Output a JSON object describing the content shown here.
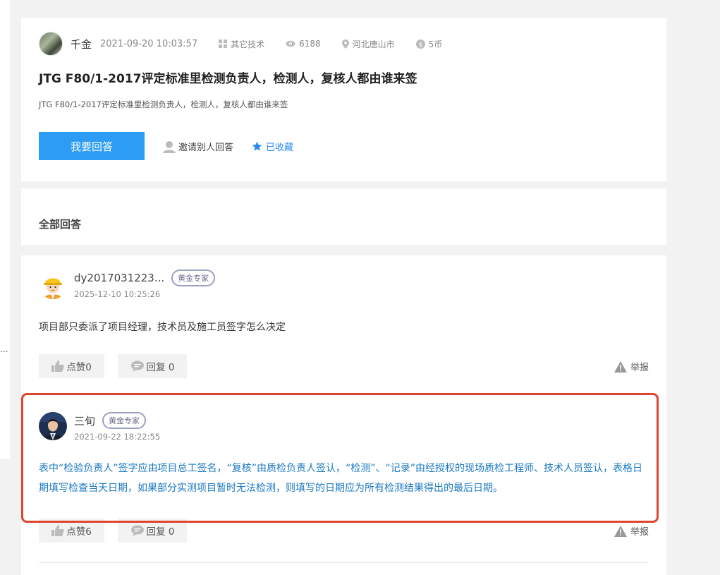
{
  "left_strip": {
    "ellipsis": "..."
  },
  "question": {
    "user": "千金",
    "time": "2021-09-20 10:03:57",
    "category": "其它技术",
    "views": "6188",
    "location": "河北唐山市",
    "reward": "5币",
    "title": "JTG F80/1-2017评定标准里检测负责人，检测人，复核人都由谁来签",
    "description": "JTG F80/1-2017评定标准里检测负责人，检测人，复核人都由谁来签",
    "answer_button": "我要回答",
    "invite_label": "邀请别人回答",
    "favorite_label": "已收藏",
    "favorite_color": "#2d8cf0",
    "answer_button_color": "#2d9cf5"
  },
  "all_answers_title": "全部回答",
  "answers": [
    {
      "user": "dy2017031223...",
      "badge": "黄金专家",
      "time": "2025-12-10 10:25:26",
      "text": "项目部只委派了项目经理，技术员及施工员签字怎么决定",
      "like_label": "点赞0",
      "reply_label": "回复 0",
      "report_label": "举报",
      "avatar_icon": "worker-helmet-avatar"
    },
    {
      "user": "三旬",
      "badge": "黄金专家",
      "time": "2021-09-22 18:22:55",
      "text": "表中“检验负责人”签字应由项目总工签名，“复核”由质检负责人签认，“检测”、“记录”由经授权的现场质检工程师、技术人员签认，表格日期填写检查当天日期，如果部分实测项目暂时无法检测，则填写的日期应为所有检测结果得出的最后日期。",
      "like_label": "点赞6",
      "reply_label": "回复 0",
      "report_label": "举报",
      "avatar_icon": "man-in-suit-avatar"
    }
  ],
  "highlight_color": "#e0452f"
}
